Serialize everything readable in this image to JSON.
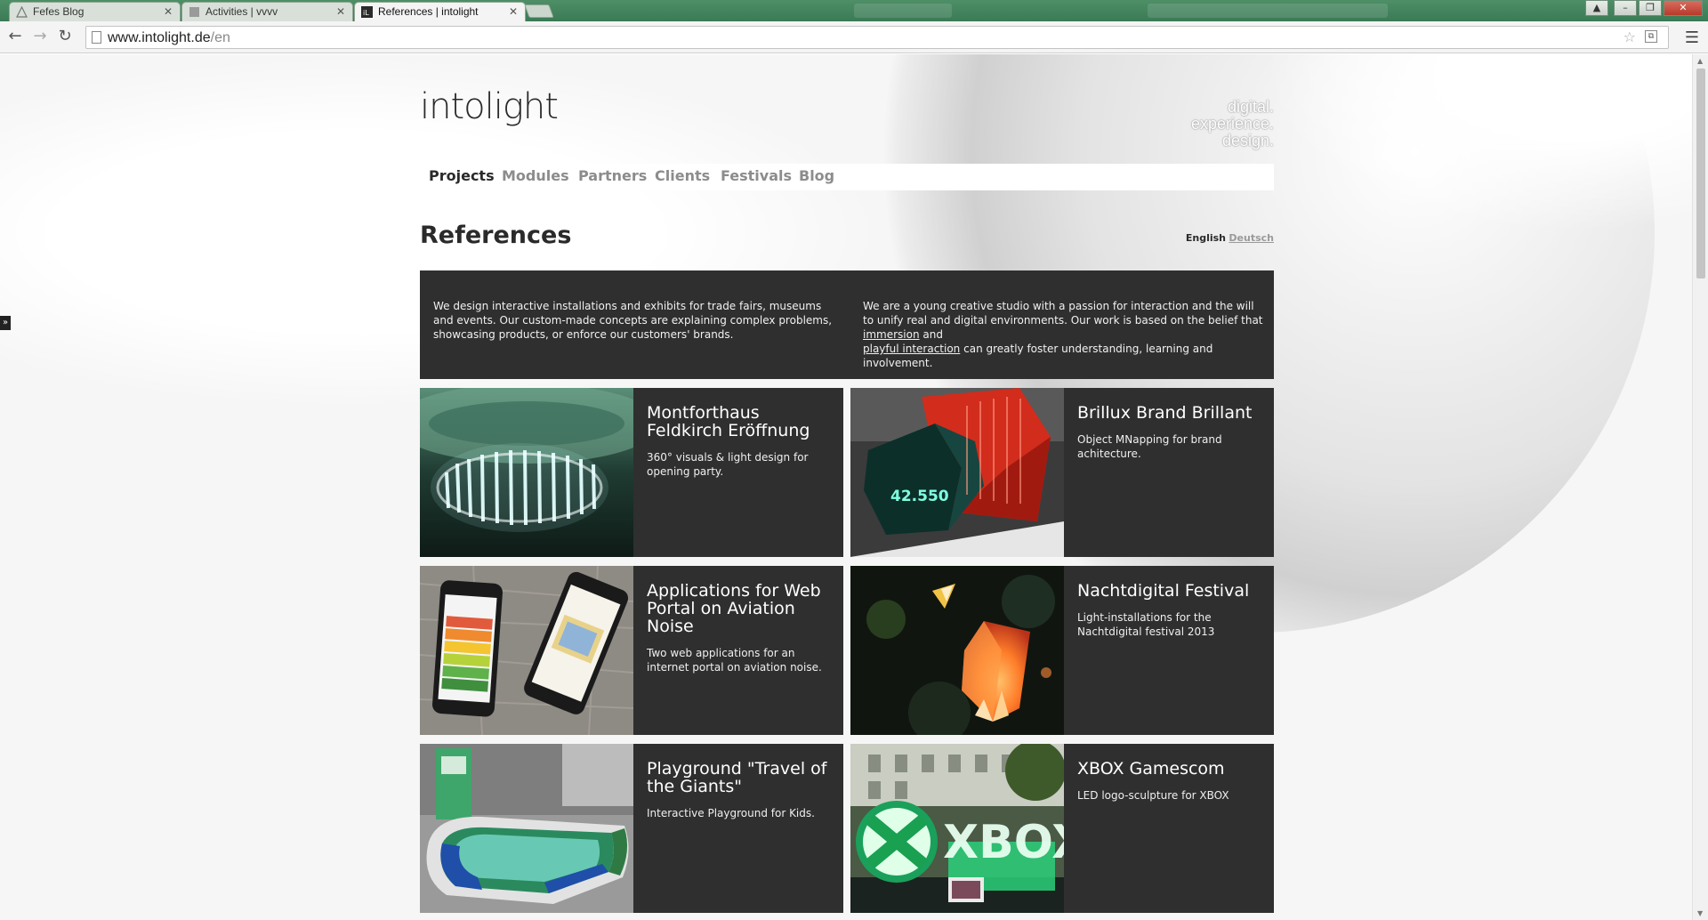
{
  "browser": {
    "tabs": [
      {
        "title": "Fefes Blog",
        "active": false
      },
      {
        "title": "Activities | vvvv",
        "active": false
      },
      {
        "title": "References | intolight",
        "active": true
      }
    ],
    "url_host": "www.intolight.de",
    "url_path": "/en",
    "window_controls": [
      "minimize",
      "maximize",
      "close"
    ]
  },
  "site": {
    "logo": "intolight",
    "tagline": [
      "digital.",
      "experience.",
      "design."
    ],
    "nav": [
      {
        "label": "Projects",
        "active": true
      },
      {
        "label": "Modules",
        "active": false
      },
      {
        "label": "Partners",
        "active": false
      },
      {
        "label": "Clients",
        "active": false
      },
      {
        "label": "Festivals",
        "active": false
      },
      {
        "label": "Blog",
        "active": false
      }
    ],
    "page_title": "References",
    "languages": {
      "english": "English",
      "deutsch": "Deutsch"
    },
    "intro": {
      "left": "We design interactive installations and exhibits for trade fairs, museums and events. Our custom-made concepts are explaining complex problems, showcasing products, or enforce our customers' brands.",
      "right_before": "We are a young creative studio with a passion for interaction and the will to unify real and digital environments. Our work is based on the belief that ",
      "right_link1": "immersion",
      "right_middle": " and ",
      "right_link2": "playful interaction",
      "right_after": " can greatly foster understanding, learning and involvement."
    },
    "projects": [
      {
        "title": "Montforthaus Feldkirch Eröffnung",
        "desc": "360° visuals & light design for opening party."
      },
      {
        "title": "Brillux Brand Brillant",
        "desc": "Object MNapping for brand achitecture.",
        "image_text": "42.550"
      },
      {
        "title": "Applications for Web Portal on Aviation Noise",
        "desc": "Two web applications for an internet portal on aviation noise."
      },
      {
        "title": "Nachtdigital Festival",
        "desc": "Light-installations for the Nachtdigital festival 2013"
      },
      {
        "title": "Playground \"Travel of the Giants\"",
        "desc": "Interactive Playground for Kids."
      },
      {
        "title": "XBOX Gamescom",
        "desc": "LED logo-sculpture for XBOX",
        "image_text": "XBOX"
      }
    ]
  },
  "colors": {
    "card_bg": "#2f2f2f",
    "text_dark": "#2a2a2a",
    "nav_inactive": "#8c8c8c",
    "chrome_green": "#3f7f59"
  }
}
